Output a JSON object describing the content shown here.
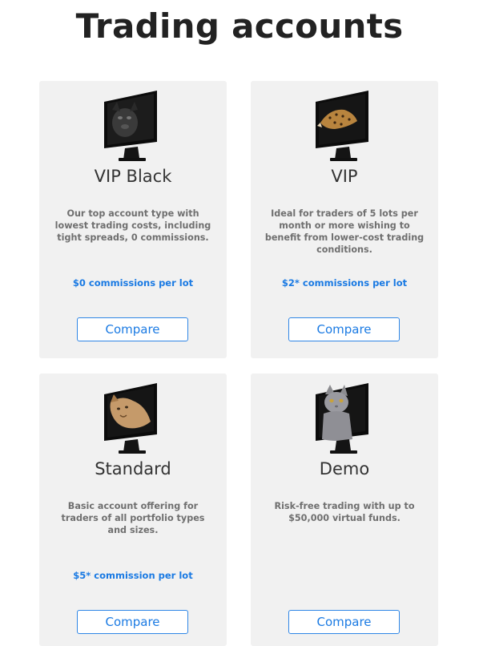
{
  "page": {
    "title": "Trading accounts"
  },
  "cards": [
    {
      "title": "VIP Black",
      "description": "Our top account type with lowest trading costs, including tight spreads, 0 commissions.",
      "commission": "$0 commissions per lot",
      "button": "Compare",
      "icon": "panther-monitor-icon"
    },
    {
      "title": "VIP",
      "description": "Ideal for traders of 5 lots per month or more wishing to benefit from lower-cost trading conditions.",
      "commission": "$2* commissions per lot",
      "button": "Compare",
      "icon": "leopard-monitor-icon"
    },
    {
      "title": "Standard",
      "description": "Basic account offering for traders of all portfolio types and sizes.",
      "commission": "$5* commission per lot",
      "button": "Compare",
      "icon": "cougar-monitor-icon"
    },
    {
      "title": "Demo",
      "description": "Risk-free trading with up to $50,000 virtual funds.",
      "commission": "",
      "button": "Compare",
      "icon": "cat-monitor-icon"
    }
  ],
  "colors": {
    "accent": "#1a7ae3",
    "card_bg": "#f1f1f1",
    "title": "#222222"
  }
}
